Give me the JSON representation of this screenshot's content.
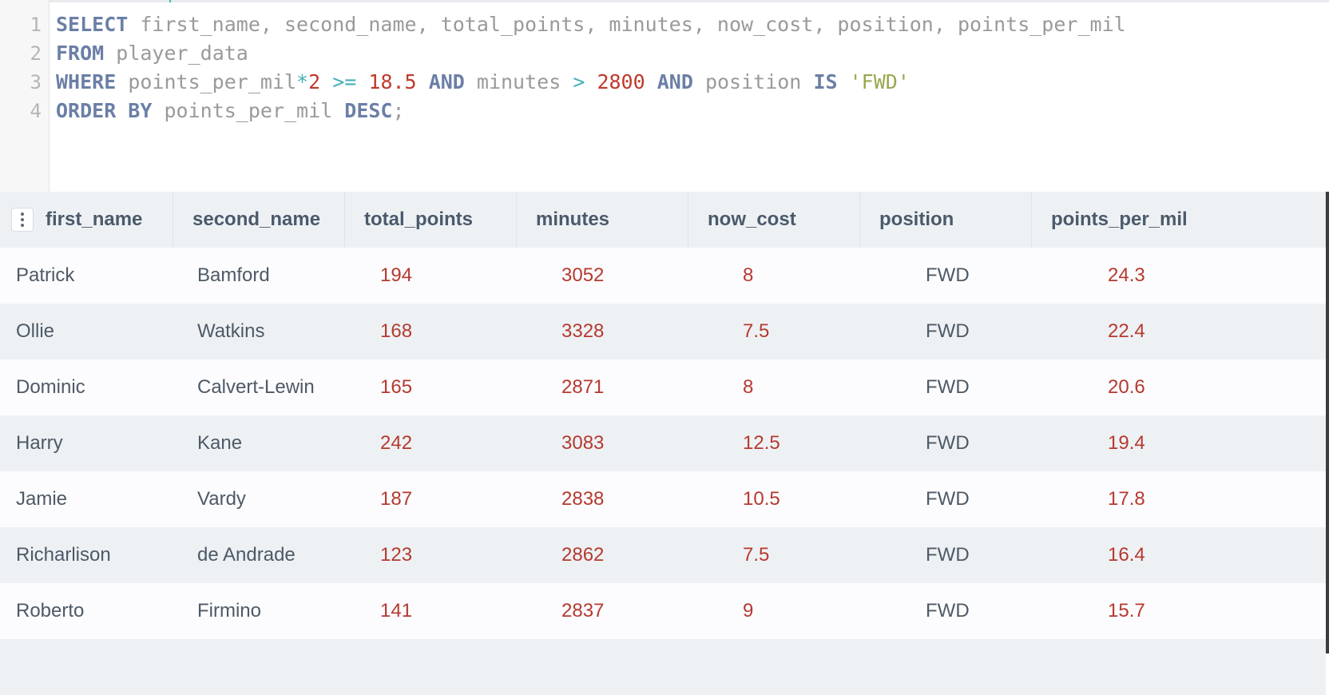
{
  "editor": {
    "lines": [
      {
        "number": "1",
        "tokens": [
          {
            "t": "SELECT",
            "c": "kw"
          },
          {
            "t": " ",
            "c": "punc"
          },
          {
            "t": "first_name",
            "c": "id"
          },
          {
            "t": ", ",
            "c": "punc"
          },
          {
            "t": "second_name",
            "c": "id"
          },
          {
            "t": ", ",
            "c": "punc"
          },
          {
            "t": "total_points",
            "c": "id"
          },
          {
            "t": ", ",
            "c": "punc"
          },
          {
            "t": "minutes",
            "c": "id"
          },
          {
            "t": ", ",
            "c": "punc"
          },
          {
            "t": "now_cost",
            "c": "id"
          },
          {
            "t": ", ",
            "c": "punc"
          },
          {
            "t": "position",
            "c": "id"
          },
          {
            "t": ", ",
            "c": "punc"
          },
          {
            "t": "points_per_mil",
            "c": "id"
          }
        ]
      },
      {
        "number": "2",
        "tokens": [
          {
            "t": "FROM",
            "c": "kw"
          },
          {
            "t": " ",
            "c": "punc"
          },
          {
            "t": "player_data",
            "c": "id"
          }
        ]
      },
      {
        "number": "3",
        "tokens": [
          {
            "t": "WHERE",
            "c": "kw"
          },
          {
            "t": " ",
            "c": "punc"
          },
          {
            "t": "points_per_mil",
            "c": "id"
          },
          {
            "t": "*",
            "c": "op"
          },
          {
            "t": "2",
            "c": "num"
          },
          {
            "t": " ",
            "c": "punc"
          },
          {
            "t": ">=",
            "c": "op"
          },
          {
            "t": " ",
            "c": "punc"
          },
          {
            "t": "18.5",
            "c": "num"
          },
          {
            "t": " ",
            "c": "punc"
          },
          {
            "t": "AND",
            "c": "kw"
          },
          {
            "t": " ",
            "c": "punc"
          },
          {
            "t": "minutes",
            "c": "id"
          },
          {
            "t": " ",
            "c": "punc"
          },
          {
            "t": ">",
            "c": "op"
          },
          {
            "t": " ",
            "c": "punc"
          },
          {
            "t": "2800",
            "c": "num"
          },
          {
            "t": " ",
            "c": "punc"
          },
          {
            "t": "AND",
            "c": "kw"
          },
          {
            "t": " ",
            "c": "punc"
          },
          {
            "t": "position",
            "c": "id"
          },
          {
            "t": " ",
            "c": "punc"
          },
          {
            "t": "IS",
            "c": "kw"
          },
          {
            "t": " ",
            "c": "punc"
          },
          {
            "t": "'FWD'",
            "c": "str"
          }
        ]
      },
      {
        "number": "4",
        "tokens": [
          {
            "t": "ORDER BY",
            "c": "kw"
          },
          {
            "t": " ",
            "c": "punc"
          },
          {
            "t": "points_per_mil",
            "c": "id"
          },
          {
            "t": " ",
            "c": "punc"
          },
          {
            "t": "DESC",
            "c": "kw"
          },
          {
            "t": ";",
            "c": "punc"
          }
        ]
      }
    ]
  },
  "results": {
    "menu_icon": "vertical-ellipsis-icon",
    "columns": [
      "first_name",
      "second_name",
      "total_points",
      "minutes",
      "now_cost",
      "position",
      "points_per_mil"
    ],
    "numeric_columns": [
      2,
      3,
      4,
      6
    ],
    "rows": [
      [
        "Patrick",
        "Bamford",
        "194",
        "3052",
        "8",
        "FWD",
        "24.3"
      ],
      [
        "Ollie",
        "Watkins",
        "168",
        "3328",
        "7.5",
        "FWD",
        "22.4"
      ],
      [
        "Dominic",
        "Calvert-Lewin",
        "165",
        "2871",
        "8",
        "FWD",
        "20.6"
      ],
      [
        "Harry",
        "Kane",
        "242",
        "3083",
        "12.5",
        "FWD",
        "19.4"
      ],
      [
        "Jamie",
        "Vardy",
        "187",
        "2838",
        "10.5",
        "FWD",
        "17.8"
      ],
      [
        "Richarlison",
        "de Andrade",
        "123",
        "2862",
        "7.5",
        "FWD",
        "16.4"
      ],
      [
        "Roberto",
        "Firmino",
        "141",
        "2837",
        "9",
        "FWD",
        "15.7"
      ]
    ]
  },
  "colors": {
    "keyword": "#6b7fa6",
    "identifier": "#9a9a9a",
    "operator": "#45b0b9",
    "number": "#c0392b",
    "string": "#97a84f",
    "numeric_cell": "#b53a2f",
    "header_bg": "#eef1f4"
  }
}
